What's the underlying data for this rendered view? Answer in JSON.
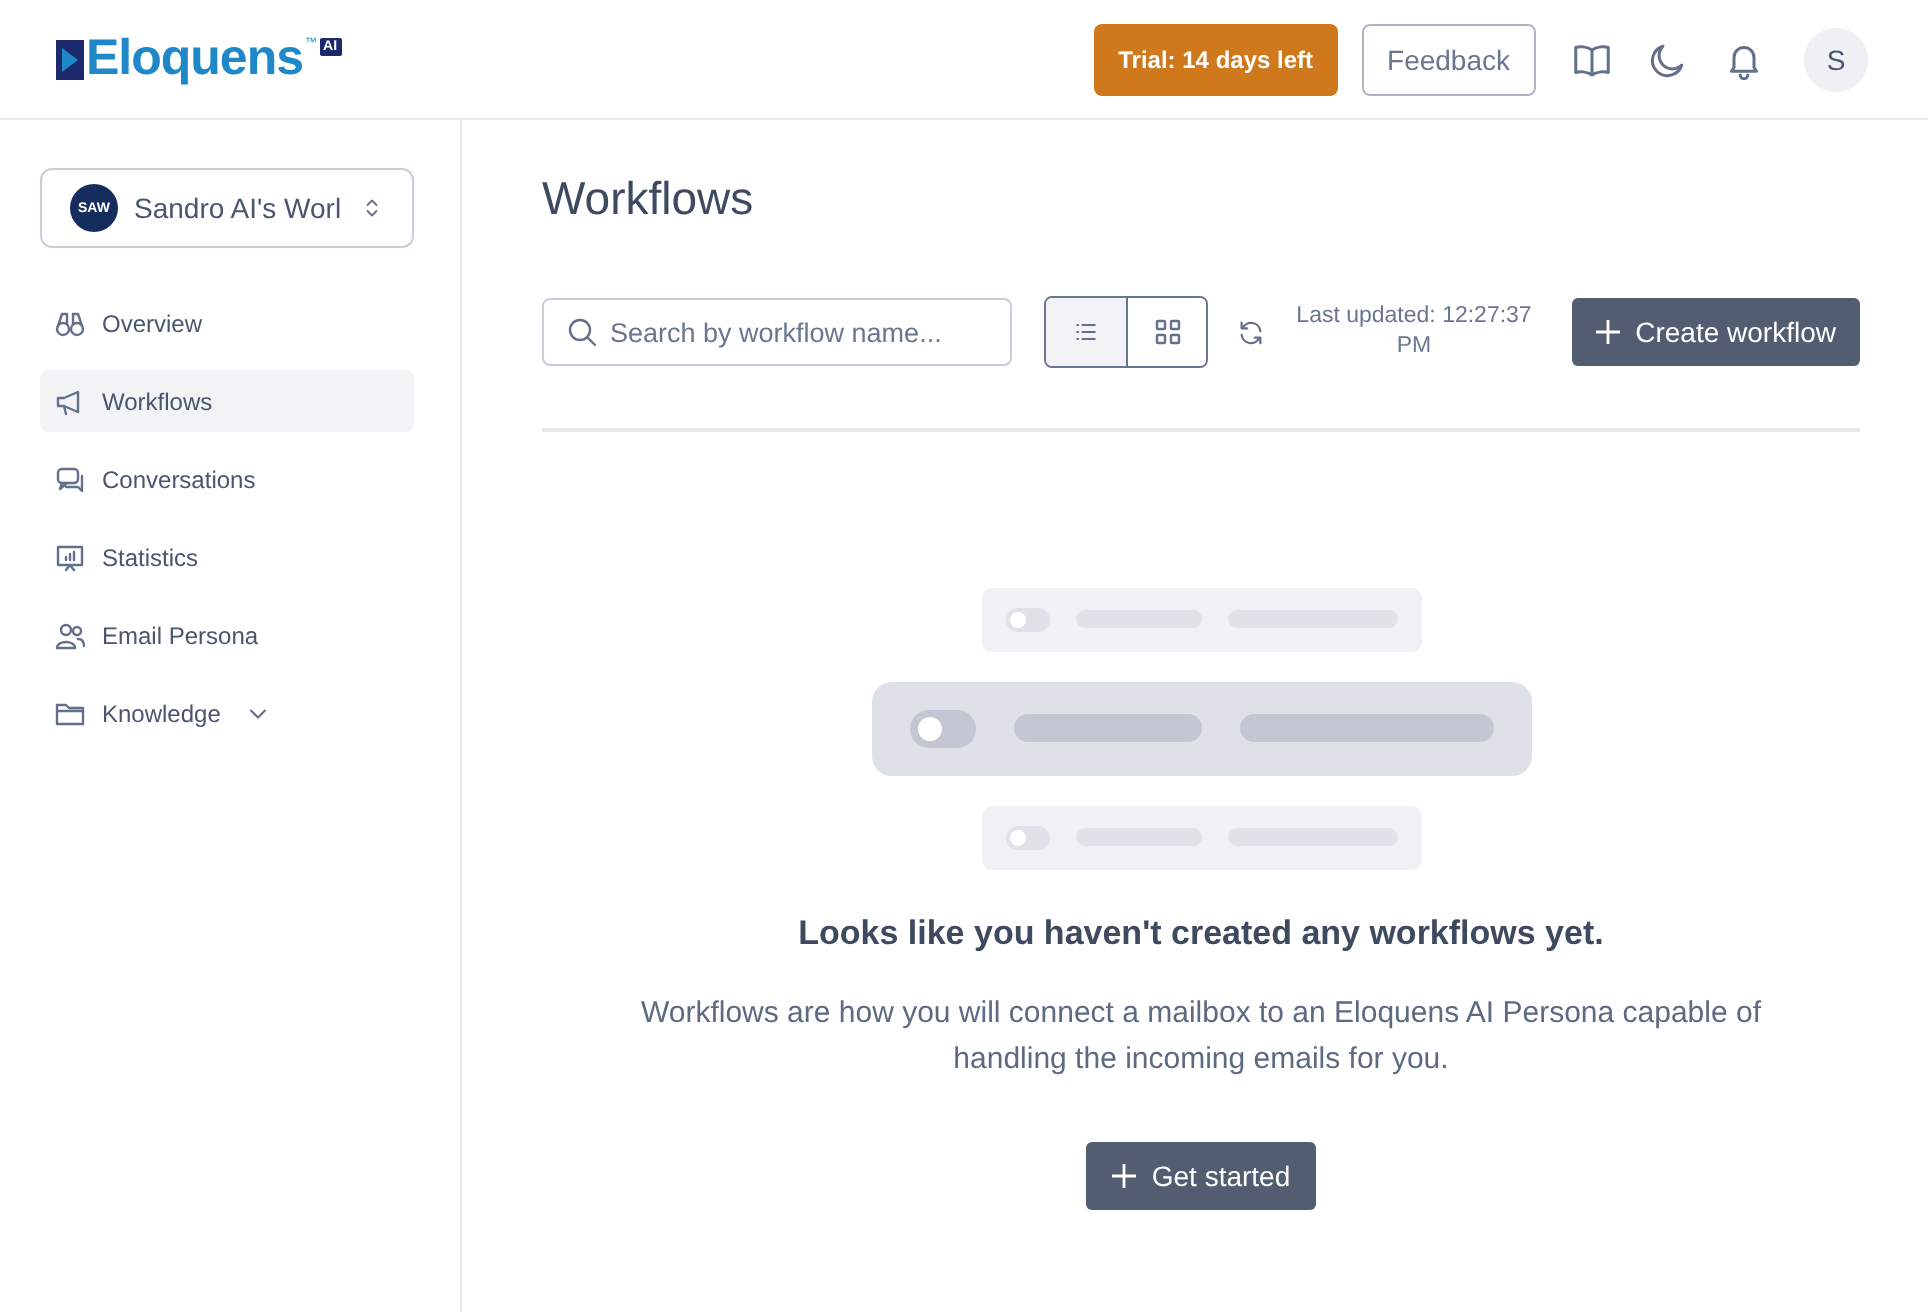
{
  "header": {
    "logo": "Eloquens",
    "logo_tm": "™",
    "logo_badge": "AI",
    "trial": "Trial: 14 days left",
    "feedback": "Feedback",
    "avatar": "S"
  },
  "sidebar": {
    "workspace": {
      "avatar": "SAW",
      "name": "Sandro AI's Worl"
    },
    "items": [
      {
        "label": "Overview",
        "selected": false
      },
      {
        "label": "Workflows",
        "selected": true
      },
      {
        "label": "Conversations",
        "selected": false
      },
      {
        "label": "Statistics",
        "selected": false
      },
      {
        "label": "Email Persona",
        "selected": false
      },
      {
        "label": "Knowledge",
        "selected": false,
        "expanded": false
      }
    ]
  },
  "main": {
    "title": "Workflows",
    "search": {
      "placeholder": "Search by workflow name..."
    },
    "views": [
      {
        "kind": "list",
        "selected": true
      },
      {
        "kind": "grid",
        "selected": false
      }
    ],
    "last_updated": "Last updated: 12:27:37 PM",
    "create": "Create workflow",
    "empty": {
      "heading": "Looks like you haven't created any workflows yet.",
      "text": "Workflows are how you will connect a mailbox to an Eloquens AI Persona capable of handling the incoming emails for you.",
      "button": "Get started"
    }
  }
}
